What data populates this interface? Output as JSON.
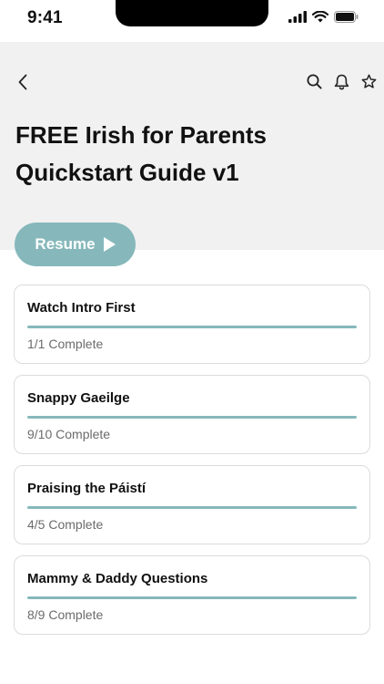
{
  "status_bar": {
    "time": "9:41",
    "icons": [
      "signal-icon",
      "wifi-icon",
      "battery-icon"
    ]
  },
  "header": {
    "back_icon": "chevron-left-icon",
    "actions": [
      "search-icon",
      "bell-icon",
      "star-icon"
    ],
    "title": "FREE Irish for Parents Quickstart Guide v1",
    "background": "#f1f1f1"
  },
  "resume": {
    "label": "Resume",
    "icon": "play-icon",
    "color": "#86b8bb"
  },
  "lessons": [
    {
      "title": "Watch Intro First",
      "progress_text": "1/1 Complete",
      "progress": 1.0
    },
    {
      "title": "Snappy Gaeilge",
      "progress_text": "9/10 Complete",
      "progress": 1.0
    },
    {
      "title": "Praising the Páistí",
      "progress_text": "4/5 Complete",
      "progress": 1.0
    },
    {
      "title": "Mammy & Daddy Questions",
      "progress_text": "8/9 Complete",
      "progress": 1.0
    }
  ],
  "colors": {
    "accent": "#86b8bb",
    "card_border": "#dcdcdc",
    "muted_text": "#6b6b6b"
  }
}
